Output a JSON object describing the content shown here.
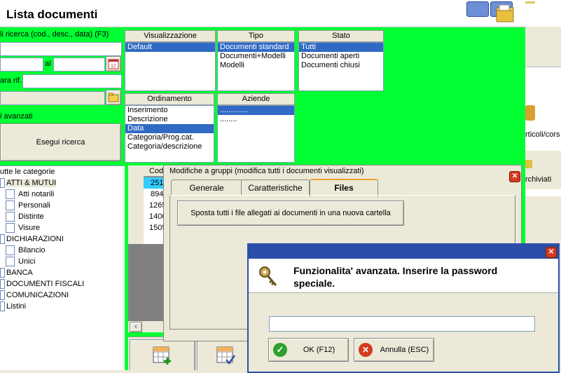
{
  "window": {
    "title": "Lista documenti"
  },
  "search": {
    "label": "li ricerca (cod., desc., data) (F3)",
    "al_label": "al",
    "rif_label": "ara rif.",
    "advanced_label": "i avanzati",
    "execute_button": "Esegui ricerca"
  },
  "visualizzazione": {
    "header": "Visualizzazione",
    "items": [
      "Default"
    ],
    "selected": 0
  },
  "tipo": {
    "header": "Tipo",
    "items": [
      "Documenti standard",
      "Documenti+Modelli",
      "Modelli"
    ],
    "selected": 0
  },
  "stato": {
    "header": "Stato",
    "items": [
      "Tutti",
      "Documenti aperti",
      "Documenti chiusi"
    ],
    "selected": 0
  },
  "ordinamento": {
    "header": "Ordinamento",
    "items": [
      "Inserimento",
      "Descrizione",
      "Data",
      "Categoria/Prog.cat.",
      "Categoria/descrizione"
    ],
    "selected": 2
  },
  "aziende": {
    "header": "Aziende",
    "items": [
      ".............",
      "........"
    ]
  },
  "tree": {
    "root": "utte le categorie",
    "items": [
      {
        "label": "ATTI & MUTUI",
        "level": 0
      },
      {
        "label": "Atti notarili",
        "level": 1
      },
      {
        "label": "Personali",
        "level": 1
      },
      {
        "label": "Distinte",
        "level": 1
      },
      {
        "label": "Visure",
        "level": 1
      },
      {
        "label": "DICHIARAZIONI",
        "level": 0
      },
      {
        "label": "Bilancio",
        "level": 1
      },
      {
        "label": "Unici",
        "level": 1
      },
      {
        "label": "BANCA",
        "level": 0
      },
      {
        "label": "DOCUMENTI FISCALI",
        "level": 0
      },
      {
        "label": "COMUNICAZIONI",
        "level": 0
      },
      {
        "label": "Listini",
        "level": 0
      }
    ]
  },
  "grid": {
    "column": "Cod",
    "rows": [
      "251",
      "894",
      "1265",
      "1400",
      "1505"
    ]
  },
  "right_panel": {
    "item1": "rticoli/cors",
    "item2": "rchiviati"
  },
  "group_modify": {
    "title": "Modifiche a gruppi (modifica tutti i documenti visualizzati)",
    "tabs": [
      "Generale",
      "Caratteristiche",
      "Files"
    ],
    "active_tab": "Files",
    "move_button": "Sposta tutti i file allegati ai documenti in una nuova cartella"
  },
  "password_dialog": {
    "message": "Funzionalita' avanzata. Inserire la password speciale.",
    "password_value": "",
    "ok_button": "OK (F12)",
    "cancel_button": "Annulla (ESC)"
  },
  "colors": {
    "background": "#00ff33",
    "selection": "#316ac5",
    "dialog_border": "#2b4fa8"
  }
}
